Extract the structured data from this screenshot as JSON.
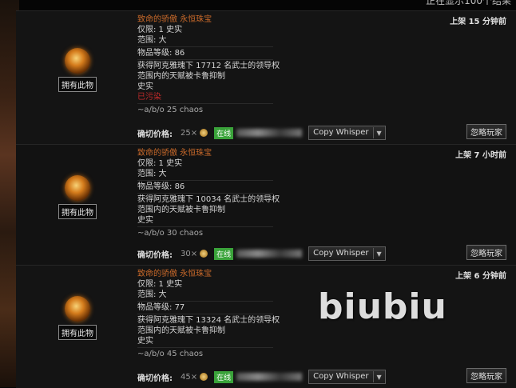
{
  "top_text": "正在显示100个结果",
  "watermark": "biubiu",
  "listings": [
    {
      "name": "致命的骄傲 永恒珠宝",
      "limit": "仅限: 1 史实",
      "range": "范围: 大",
      "level_label": "物品等级:",
      "level": "86",
      "mod1": "获得阿克雅瑰下 17712 名武士的领导权",
      "mod2": "范围内的天赋被卡鲁抑制",
      "mod3": "史实",
      "status": "已污染",
      "buyout": "~a/b/o 25 chaos",
      "posted": "上架 15 分钟前",
      "owned": "拥有此物",
      "price_label": "确切价格:",
      "price": "25×",
      "online": "在线",
      "copy": "Copy Whisper",
      "ignore": "忽略玩家"
    },
    {
      "name": "致命的骄傲 永恒珠宝",
      "limit": "仅限: 1 史实",
      "range": "范围: 大",
      "level_label": "物品等级:",
      "level": "86",
      "mod1": "获得阿克雅瑰下 10034 名武士的领导权",
      "mod2": "范围内的天赋被卡鲁抑制",
      "mod3": "史实",
      "status": "",
      "buyout": "~a/b/o 30 chaos",
      "posted": "上架 7 小时前",
      "owned": "拥有此物",
      "price_label": "确切价格:",
      "price": "30×",
      "online": "在线",
      "copy": "Copy Whisper",
      "ignore": "忽略玩家"
    },
    {
      "name": "致命的骄傲 永恒珠宝",
      "limit": "仅限: 1 史实",
      "range": "范围: 大",
      "level_label": "物品等级:",
      "level": "77",
      "mod1": "获得阿克雅瑰下 13324 名武士的领导权",
      "mod2": "范围内的天赋被卡鲁抑制",
      "mod3": "史实",
      "status": "",
      "buyout": "~a/b/o 45 chaos",
      "posted": "上架 6 分钟前",
      "owned": "拥有此物",
      "price_label": "确切价格:",
      "price": "45×",
      "online": "在线",
      "copy": "Copy Whisper",
      "ignore": "忽略玩家"
    }
  ]
}
